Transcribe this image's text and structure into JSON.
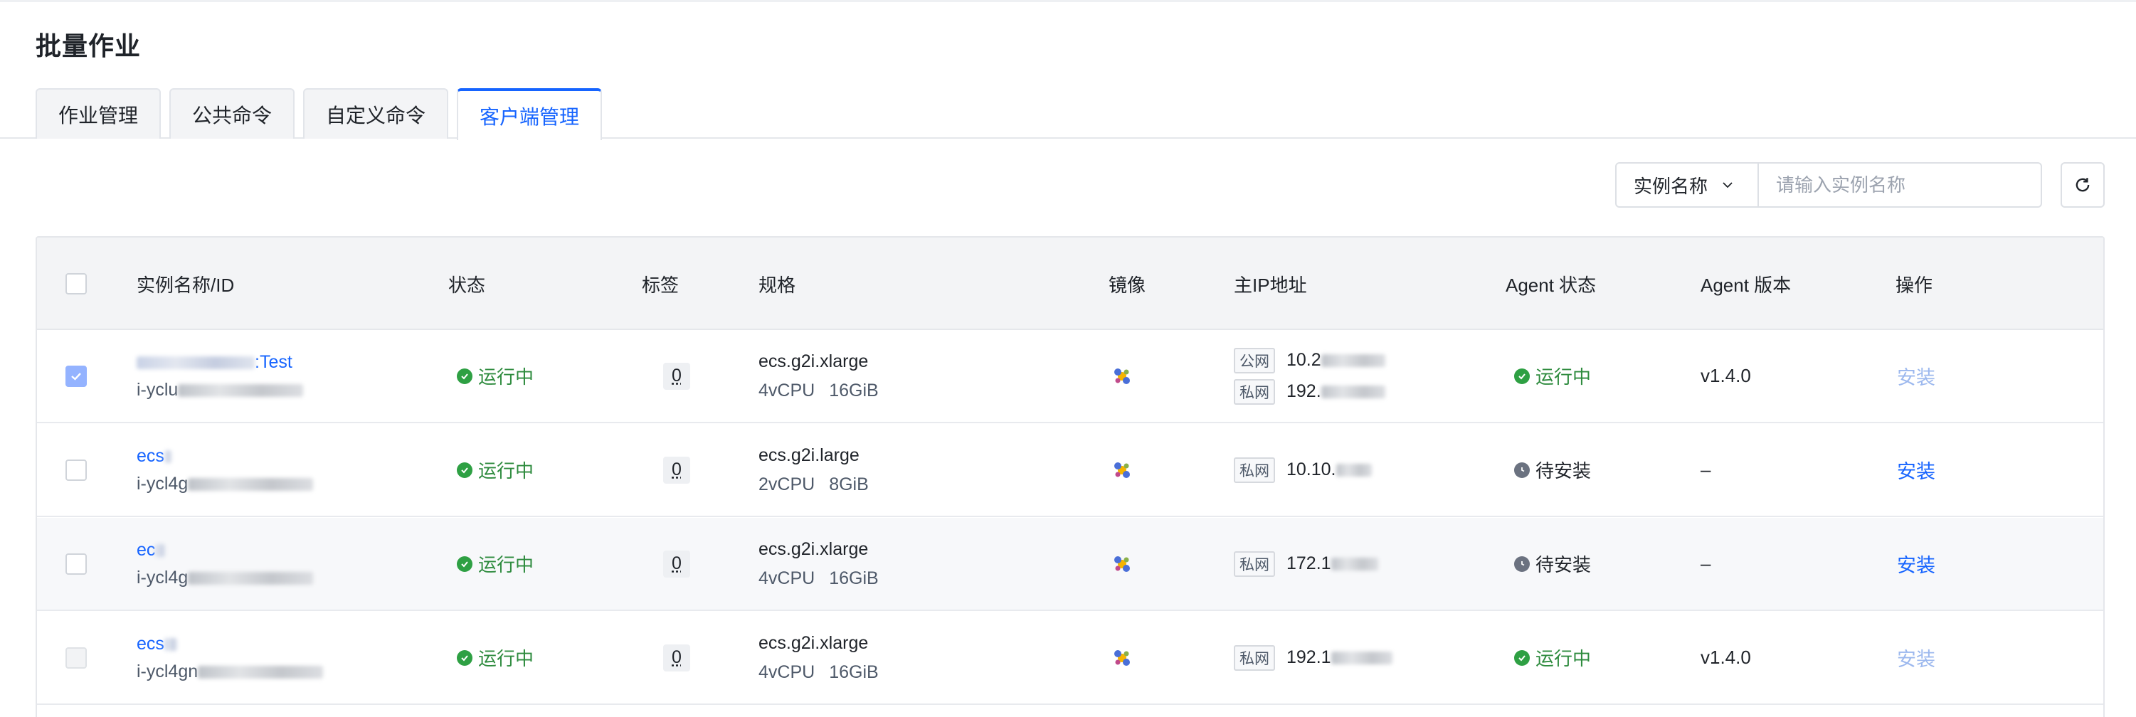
{
  "page": {
    "title": "批量作业"
  },
  "tabs": [
    {
      "label": "作业管理",
      "active": false
    },
    {
      "label": "公共命令",
      "active": false
    },
    {
      "label": "自定义命令",
      "active": false
    },
    {
      "label": "客户端管理",
      "active": true
    }
  ],
  "search": {
    "field_label": "实例名称",
    "placeholder": "请输入实例名称"
  },
  "table": {
    "columns": {
      "name": "实例名称/ID",
      "status": "状态",
      "tags": "标签",
      "spec": "规格",
      "image": "镜像",
      "ip": "主IP地址",
      "agent_status": "Agent 状态",
      "agent_version": "Agent 版本",
      "actions": "操作"
    },
    "rows": [
      {
        "checked": true,
        "disabled": false,
        "name_suffix": ":Test",
        "id_prefix": "i-yclu",
        "status": "运行中",
        "tag_count": "0",
        "spec": "ecs.g2i.xlarge",
        "cpu": "4vCPU",
        "mem": "16GiB",
        "ips": [
          {
            "type": "公网",
            "value": "10.2"
          },
          {
            "type": "私网",
            "value": "192."
          }
        ],
        "agent_status": "运行中",
        "agent_state": "running",
        "agent_version": "v1.4.0",
        "action": "安装",
        "action_enabled": false
      },
      {
        "checked": false,
        "disabled": false,
        "name_suffix": "ecs",
        "id_prefix": "i-ycl4g",
        "status": "运行中",
        "tag_count": "0",
        "spec": "ecs.g2i.large",
        "cpu": "2vCPU",
        "mem": "8GiB",
        "ips": [
          {
            "type": "私网",
            "value": "10.10."
          }
        ],
        "agent_status": "待安装",
        "agent_state": "pending",
        "agent_version": "–",
        "action": "安装",
        "action_enabled": true
      },
      {
        "checked": false,
        "disabled": false,
        "name_suffix": "ec",
        "id_prefix": "i-ycl4g",
        "status": "运行中",
        "tag_count": "0",
        "spec": "ecs.g2i.xlarge",
        "cpu": "4vCPU",
        "mem": "16GiB",
        "ips": [
          {
            "type": "私网",
            "value": "172.1"
          }
        ],
        "agent_status": "待安装",
        "agent_state": "pending",
        "agent_version": "–",
        "action": "安装",
        "action_enabled": true
      },
      {
        "checked": false,
        "disabled": true,
        "name_suffix": "ecs",
        "id_prefix": "i-ycl4gn",
        "status": "运行中",
        "tag_count": "0",
        "spec": "ecs.g2i.xlarge",
        "cpu": "4vCPU",
        "mem": "16GiB",
        "ips": [
          {
            "type": "私网",
            "value": "192.1"
          }
        ],
        "agent_status": "运行中",
        "agent_state": "running",
        "agent_version": "v1.4.0",
        "action": "安装",
        "action_enabled": false
      }
    ]
  },
  "colors": {
    "primary": "#1664ff",
    "success": "#2ea043",
    "pending": "#6b7280"
  }
}
